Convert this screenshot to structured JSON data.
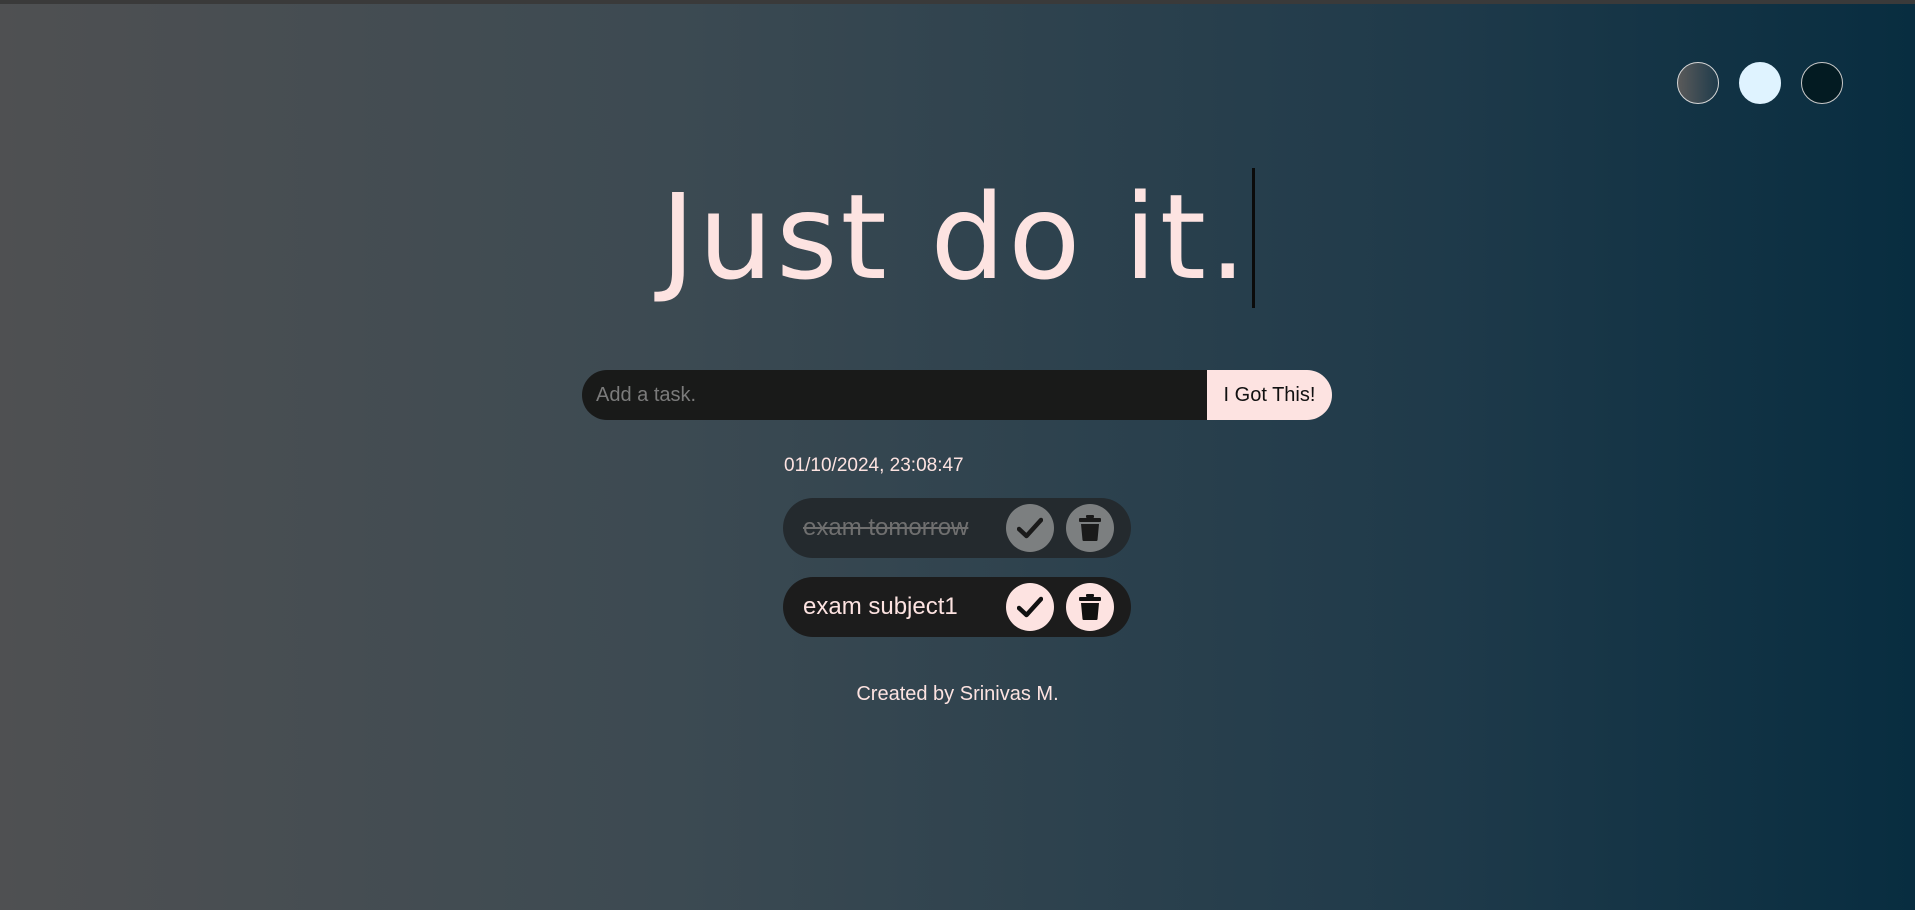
{
  "themes": [
    {
      "name": "standard"
    },
    {
      "name": "light"
    },
    {
      "name": "darker"
    }
  ],
  "header": {
    "title": "Just do it."
  },
  "form": {
    "placeholder": "Add a task.",
    "value": "",
    "submit_label": "I Got This!"
  },
  "datetime": "01/10/2024, 23:08:47",
  "todos": [
    {
      "text": "exam tomorrow",
      "completed": true
    },
    {
      "text": "exam subject1",
      "completed": false
    }
  ],
  "icons": {
    "check": "check-icon",
    "delete": "trash-icon"
  },
  "colors": {
    "accent": "#fde3e1",
    "input_bg": "#191a19",
    "completed_bg": "#242a2e",
    "pending_bg": "#1c1c1c"
  },
  "footer": {
    "text": "Created by Srinivas M."
  }
}
